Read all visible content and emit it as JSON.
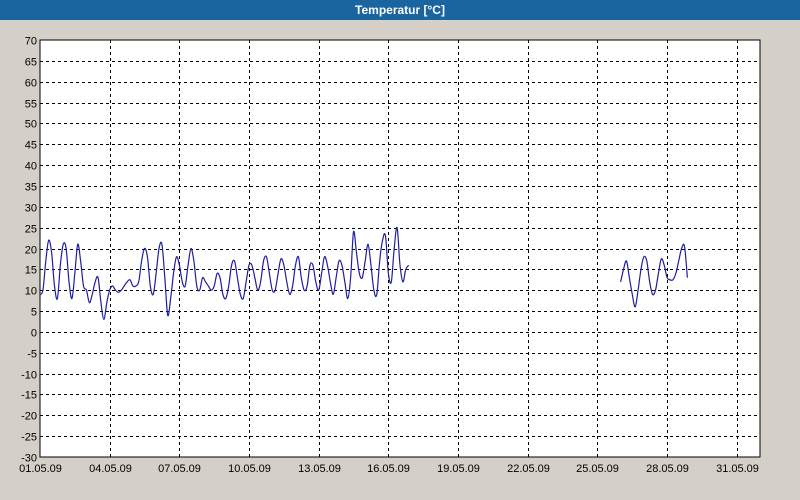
{
  "window": {
    "title": "Temperatur [°C]"
  },
  "colors": {
    "background": "#d4d0c8",
    "plot": "#ffffff",
    "series": "#1e1ea0",
    "grid": "#000000"
  },
  "chart_data": {
    "type": "line",
    "title": "Temperatur [°C]",
    "xlabel": "",
    "ylabel": "",
    "ylim": [
      -30,
      70
    ],
    "y_ticks": [
      70,
      65,
      60,
      55,
      50,
      45,
      40,
      35,
      30,
      25,
      20,
      15,
      10,
      5,
      0,
      -5,
      -10,
      -15,
      -20,
      -25,
      -30
    ],
    "xlim": [
      "2009-05-01",
      "2009-06-01"
    ],
    "x_ticks": [
      "01.05.09",
      "04.05.09",
      "07.05.09",
      "10.05.09",
      "13.05.09",
      "16.05.09",
      "19.05.09",
      "22.05.09",
      "25.05.09",
      "28.05.09",
      "31.05.09"
    ],
    "grid": true,
    "series": [
      {
        "segments": [
          [
            [
              "2009-05-01 00:00",
              9
            ],
            [
              "2009-05-01 03:00",
              10
            ],
            [
              "2009-05-01 06:00",
              17
            ],
            [
              "2009-05-01 09:00",
              22
            ],
            [
              "2009-05-01 12:00",
              19
            ],
            [
              "2009-05-01 15:00",
              11
            ],
            [
              "2009-05-01 18:00",
              8
            ],
            [
              "2009-05-01 21:00",
              16
            ],
            [
              "2009-05-02 00:00",
              21
            ],
            [
              "2009-05-02 03:00",
              20
            ],
            [
              "2009-05-02 06:00",
              12
            ],
            [
              "2009-05-02 09:00",
              8
            ],
            [
              "2009-05-02 12:00",
              14
            ],
            [
              "2009-05-02 15:00",
              21
            ],
            [
              "2009-05-02 18:00",
              17
            ],
            [
              "2009-05-02 21:00",
              11
            ],
            [
              "2009-05-03 00:00",
              10
            ],
            [
              "2009-05-03 03:00",
              7
            ],
            [
              "2009-05-03 06:00",
              9
            ],
            [
              "2009-05-03 09:00",
              12
            ],
            [
              "2009-05-03 12:00",
              13
            ],
            [
              "2009-05-03 15:00",
              7
            ],
            [
              "2009-05-03 18:00",
              3
            ],
            [
              "2009-05-03 21:00",
              7
            ],
            [
              "2009-05-04 00:00",
              10
            ],
            [
              "2009-05-04 03:00",
              11
            ],
            [
              "2009-05-04 06:00",
              10
            ],
            [
              "2009-05-04 09:00",
              9.5
            ],
            [
              "2009-05-04 12:00",
              10
            ],
            [
              "2009-05-04 15:00",
              11
            ],
            [
              "2009-05-04 18:00",
              12
            ],
            [
              "2009-05-04 21:00",
              12.5
            ],
            [
              "2009-05-05 00:00",
              11
            ],
            [
              "2009-05-05 03:00",
              11
            ],
            [
              "2009-05-05 06:00",
              12
            ],
            [
              "2009-05-05 09:00",
              17
            ],
            [
              "2009-05-05 12:00",
              20
            ],
            [
              "2009-05-05 15:00",
              18
            ],
            [
              "2009-05-05 18:00",
              11
            ],
            [
              "2009-05-05 21:00",
              9
            ],
            [
              "2009-05-06 00:00",
              14
            ],
            [
              "2009-05-06 03:00",
              20
            ],
            [
              "2009-05-06 06:00",
              21
            ],
            [
              "2009-05-06 09:00",
              13
            ],
            [
              "2009-05-06 12:00",
              4
            ],
            [
              "2009-05-06 15:00",
              8
            ],
            [
              "2009-05-06 18:00",
              14
            ],
            [
              "2009-05-06 21:00",
              18
            ],
            [
              "2009-05-07 00:00",
              16
            ],
            [
              "2009-05-07 03:00",
              12
            ],
            [
              "2009-05-07 06:00",
              11
            ],
            [
              "2009-05-07 09:00",
              16
            ],
            [
              "2009-05-07 12:00",
              20
            ],
            [
              "2009-05-07 15:00",
              17
            ],
            [
              "2009-05-07 18:00",
              11
            ],
            [
              "2009-05-07 21:00",
              10
            ],
            [
              "2009-05-08 00:00",
              13
            ],
            [
              "2009-05-08 03:00",
              12
            ],
            [
              "2009-05-08 06:00",
              11
            ],
            [
              "2009-05-08 09:00",
              10
            ],
            [
              "2009-05-08 12:00",
              11
            ],
            [
              "2009-05-08 15:00",
              14
            ],
            [
              "2009-05-08 18:00",
              13
            ],
            [
              "2009-05-08 21:00",
              9
            ],
            [
              "2009-05-09 00:00",
              8
            ],
            [
              "2009-05-09 03:00",
              11
            ],
            [
              "2009-05-09 06:00",
              16
            ],
            [
              "2009-05-09 09:00",
              17
            ],
            [
              "2009-05-09 12:00",
              13
            ],
            [
              "2009-05-09 15:00",
              9
            ],
            [
              "2009-05-09 18:00",
              8
            ],
            [
              "2009-05-09 21:00",
              12
            ],
            [
              "2009-05-10 00:00",
              16
            ],
            [
              "2009-05-10 03:00",
              16
            ],
            [
              "2009-05-10 06:00",
              13
            ],
            [
              "2009-05-10 09:00",
              10
            ],
            [
              "2009-05-10 12:00",
              12
            ],
            [
              "2009-05-10 15:00",
              17
            ],
            [
              "2009-05-10 18:00",
              18
            ],
            [
              "2009-05-10 21:00",
              14
            ],
            [
              "2009-05-11 00:00",
              10
            ],
            [
              "2009-05-11 03:00",
              10
            ],
            [
              "2009-05-11 06:00",
              14
            ],
            [
              "2009-05-11 09:00",
              17.5
            ],
            [
              "2009-05-11 12:00",
              16
            ],
            [
              "2009-05-11 15:00",
              12
            ],
            [
              "2009-05-11 18:00",
              9
            ],
            [
              "2009-05-11 21:00",
              11
            ],
            [
              "2009-05-12 00:00",
              16
            ],
            [
              "2009-05-12 03:00",
              18
            ],
            [
              "2009-05-12 06:00",
              13
            ],
            [
              "2009-05-12 09:00",
              10
            ],
            [
              "2009-05-12 12:00",
              11
            ],
            [
              "2009-05-12 15:00",
              16
            ],
            [
              "2009-05-12 18:00",
              16
            ],
            [
              "2009-05-12 21:00",
              12
            ],
            [
              "2009-05-13 00:00",
              10
            ],
            [
              "2009-05-13 03:00",
              14
            ],
            [
              "2009-05-13 06:00",
              18
            ],
            [
              "2009-05-13 09:00",
              16
            ],
            [
              "2009-05-13 12:00",
              12
            ],
            [
              "2009-05-13 15:00",
              9
            ],
            [
              "2009-05-13 18:00",
              13
            ],
            [
              "2009-05-13 21:00",
              17
            ],
            [
              "2009-05-14 00:00",
              16
            ],
            [
              "2009-05-14 03:00",
              12
            ],
            [
              "2009-05-14 06:00",
              8
            ],
            [
              "2009-05-14 09:00",
              13
            ],
            [
              "2009-05-14 12:00",
              24
            ],
            [
              "2009-05-14 15:00",
              19
            ],
            [
              "2009-05-14 18:00",
              14
            ],
            [
              "2009-05-14 21:00",
              13
            ],
            [
              "2009-05-15 00:00",
              17
            ],
            [
              "2009-05-15 03:00",
              21
            ],
            [
              "2009-05-15 06:00",
              16
            ],
            [
              "2009-05-15 09:00",
              10
            ],
            [
              "2009-05-15 12:00",
              9
            ],
            [
              "2009-05-15 15:00",
              17
            ],
            [
              "2009-05-15 18:00",
              22
            ],
            [
              "2009-05-15 21:00",
              23
            ],
            [
              "2009-05-16 00:00",
              14
            ],
            [
              "2009-05-16 03:00",
              12
            ],
            [
              "2009-05-16 06:00",
              20
            ],
            [
              "2009-05-16 09:00",
              25
            ],
            [
              "2009-05-16 12:00",
              16
            ],
            [
              "2009-05-16 15:00",
              12
            ],
            [
              "2009-05-16 18:00",
              15
            ],
            [
              "2009-05-16 21:00",
              16
            ]
          ],
          [
            [
              "2009-05-26 00:00",
              12
            ],
            [
              "2009-05-26 03:00",
              15
            ],
            [
              "2009-05-26 06:00",
              17
            ],
            [
              "2009-05-26 09:00",
              13
            ],
            [
              "2009-05-26 12:00",
              9
            ],
            [
              "2009-05-26 15:00",
              6
            ],
            [
              "2009-05-26 18:00",
              10
            ],
            [
              "2009-05-26 21:00",
              15
            ],
            [
              "2009-05-27 00:00",
              18
            ],
            [
              "2009-05-27 03:00",
              17
            ],
            [
              "2009-05-27 06:00",
              12
            ],
            [
              "2009-05-27 09:00",
              9
            ],
            [
              "2009-05-27 12:00",
              10
            ],
            [
              "2009-05-27 15:00",
              14
            ],
            [
              "2009-05-27 18:00",
              17.5
            ],
            [
              "2009-05-27 21:00",
              16
            ],
            [
              "2009-05-28 00:00",
              13
            ],
            [
              "2009-05-28 03:00",
              12.5
            ],
            [
              "2009-05-28 06:00",
              12.5
            ],
            [
              "2009-05-28 09:00",
              14
            ],
            [
              "2009-05-28 12:00",
              17
            ],
            [
              "2009-05-28 15:00",
              20
            ],
            [
              "2009-05-28 18:00",
              20.5
            ],
            [
              "2009-05-28 21:00",
              13
            ]
          ]
        ]
      }
    ]
  }
}
